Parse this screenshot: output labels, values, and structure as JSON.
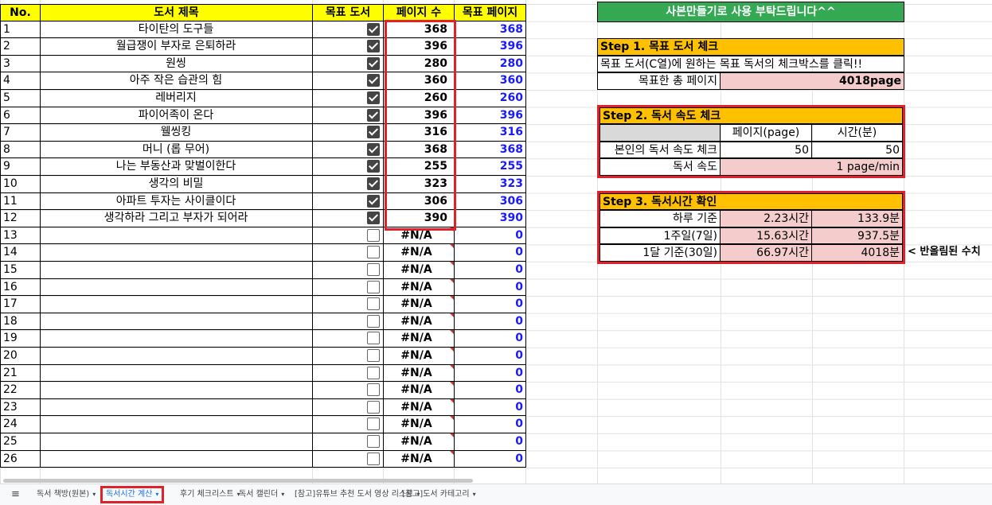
{
  "headers": {
    "no": "No.",
    "title": "도서 제목",
    "target": "목표 도서",
    "pages": "페이지 수",
    "target_pages": "목표 페이지"
  },
  "rows": [
    {
      "no": "1",
      "title": "타이탄의 도구들",
      "checked": true,
      "pages": "368",
      "target": "368"
    },
    {
      "no": "2",
      "title": "월급쟁이 부자로 은퇴하라",
      "checked": true,
      "pages": "396",
      "target": "396"
    },
    {
      "no": "3",
      "title": "원씽",
      "checked": true,
      "pages": "280",
      "target": "280"
    },
    {
      "no": "4",
      "title": "아주 작은 습관의 힘",
      "checked": true,
      "pages": "360",
      "target": "360"
    },
    {
      "no": "5",
      "title": "레버리지",
      "checked": true,
      "pages": "260",
      "target": "260"
    },
    {
      "no": "6",
      "title": "파이어족이 온다",
      "checked": true,
      "pages": "396",
      "target": "396"
    },
    {
      "no": "7",
      "title": "웰씽킹",
      "checked": true,
      "pages": "316",
      "target": "316"
    },
    {
      "no": "8",
      "title": "머니 (롭 무어)",
      "checked": true,
      "pages": "368",
      "target": "368"
    },
    {
      "no": "9",
      "title": "나는 부동산과 맞벌이한다",
      "checked": true,
      "pages": "255",
      "target": "255"
    },
    {
      "no": "10",
      "title": "생각의 비밀",
      "checked": true,
      "pages": "323",
      "target": "323"
    },
    {
      "no": "11",
      "title": "아파트 투자는 사이클이다",
      "checked": true,
      "pages": "306",
      "target": "306"
    },
    {
      "no": "12",
      "title": "생각하라 그리고 부자가 되어라",
      "checked": true,
      "pages": "390",
      "target": "390"
    },
    {
      "no": "13",
      "title": "",
      "checked": false,
      "pages": "#N/A",
      "target": "0"
    },
    {
      "no": "14",
      "title": "",
      "checked": false,
      "pages": "#N/A",
      "target": "0"
    },
    {
      "no": "15",
      "title": "",
      "checked": false,
      "pages": "#N/A",
      "target": "0"
    },
    {
      "no": "16",
      "title": "",
      "checked": false,
      "pages": "#N/A",
      "target": "0"
    },
    {
      "no": "17",
      "title": "",
      "checked": false,
      "pages": "#N/A",
      "target": "0"
    },
    {
      "no": "18",
      "title": "",
      "checked": false,
      "pages": "#N/A",
      "target": "0"
    },
    {
      "no": "19",
      "title": "",
      "checked": false,
      "pages": "#N/A",
      "target": "0"
    },
    {
      "no": "20",
      "title": "",
      "checked": false,
      "pages": "#N/A",
      "target": "0"
    },
    {
      "no": "21",
      "title": "",
      "checked": false,
      "pages": "#N/A",
      "target": "0"
    },
    {
      "no": "22",
      "title": "",
      "checked": false,
      "pages": "#N/A",
      "target": "0"
    },
    {
      "no": "23",
      "title": "",
      "checked": false,
      "pages": "#N/A",
      "target": "0"
    },
    {
      "no": "24",
      "title": "",
      "checked": false,
      "pages": "#N/A",
      "target": "0"
    },
    {
      "no": "25",
      "title": "",
      "checked": false,
      "pages": "#N/A",
      "target": "0"
    },
    {
      "no": "26",
      "title": "",
      "checked": false,
      "pages": "#N/A",
      "target": "0"
    }
  ],
  "banner": "사본만들기로 사용 부탁드립니다^^",
  "step1": {
    "title": "Step 1. 목표 도서 체크",
    "desc": "목표 도서(C열)에 원하는 목표 독서의 체크박스를 클릭!!",
    "label": "목표한 총 페이지",
    "value": "4018page"
  },
  "step2": {
    "title": "Step 2. 독서 속도 체크",
    "col_page": "페이지(page)",
    "col_time": "시간(분)",
    "check_label": "본인의 독서 속도 체크",
    "check_page": "50",
    "check_time": "50",
    "speed_label": "독서 속도",
    "speed_value": "1 page/min"
  },
  "step3": {
    "title": "Step 3. 독서시간 확인",
    "rows": [
      {
        "label": "하루 기준",
        "hours": "2.23시간",
        "minutes": "133.9분"
      },
      {
        "label": "1주일(7일)",
        "hours": "15.63시간",
        "minutes": "937.5분"
      },
      {
        "label": "1달 기준(30일)",
        "hours": "66.97시간",
        "minutes": "4018분"
      }
    ],
    "note": "< 반올림된 수치"
  },
  "tabs": [
    {
      "label": "독서 책방(원본)",
      "active": false
    },
    {
      "label": "독서시간 계산",
      "active": true
    },
    {
      "label": "후기 체크리스트",
      "active": false
    },
    {
      "label": "독서 캘린더",
      "active": false
    },
    {
      "label": "[참고]유튜브 추천 도서 영상 리스트",
      "active": false
    },
    {
      "label": "[참고]도서 카테고리",
      "active": false
    }
  ],
  "colors": {
    "header_yellow": "#ffff00",
    "step_orange": "#ffc000",
    "banner_green": "#34a853",
    "pink": "#f4cccc",
    "highlight_red": "#e0202a",
    "link_blue": "#1a1aff"
  }
}
